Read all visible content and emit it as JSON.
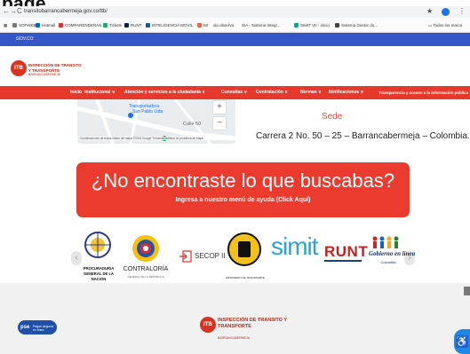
{
  "page_heading_fragment": "page",
  "browser": {
    "nav": [
      "←",
      "→",
      "C"
    ],
    "url": "transitobarrancabermeja.gov.co/ttb/",
    "right_icons": [
      "★",
      "⋮"
    ],
    "bookmarks": [
      "SOFWEB",
      "Hotmail",
      "COMPARENDERAS...",
      "Tickets",
      "RUNT",
      "INTELIGENCIA MOVIL",
      "MI",
      "sia observa",
      "SIA - Sistema Integr...",
      "SIMIT VII - inicio",
      "Sistema Gestor do..."
    ],
    "bookmarks_right": "Todos los marca"
  },
  "gov_label": "GOV.CO",
  "logo": {
    "name": "INSPECCIÓN DE TRANSITO Y TRANSPORTE",
    "sub": "BARRANCABERMEJA",
    "initials": "ITB"
  },
  "menu": [
    "Inicio",
    "Institucional ∨",
    "Atención y servicios a la ciudadanía ∨",
    "Consultas ∨",
    "Contratación ∨",
    "Normas ∨",
    "Notificaciones ∨",
    "Transparencia y acceso a la información pública"
  ],
  "map": {
    "label1": "Transportadora",
    "label2": "San Pablo Ltda",
    "road": "Calle 50",
    "plus": "+",
    "minus": "−",
    "footer": "Combinaciones de teclas   Datos del mapa ©2024 Google   Términos   Notificar un problema de Maps"
  },
  "sede": {
    "title": "Sede",
    "address": "Carrera 2 No. 50 – 25 – Barrancabermeja – Colombia."
  },
  "help": {
    "title": "¿No encontraste lo que buscabas?",
    "subtitle": "Ingresa a nuestro menú de ayuda (Click Aquí)"
  },
  "partners": {
    "prev": "‹",
    "next": "›",
    "procuraduria": "PROCURADURIA GENERAL DE LA NACION",
    "contraloria": "CONTRALORÍA",
    "contraloria_sub": "GENERAL DE LA REPÚBLICA",
    "secop": "SECOP II",
    "mintransporte": "MINISTERIO DE TRANSPORTE",
    "simit": "simit",
    "runt": "RUNT",
    "gobierno": "Gobierno en línea",
    "gobierno_sub": "Colombia"
  },
  "footer": {
    "pse": "pse",
    "pse_sub": "Pagos seguros en línea",
    "logo_name": "INSPECCIÓN DE TRANSITO Y TRANSPORTE",
    "logo_sub": "BARRANCABERMEJA",
    "access_icon": "♿"
  }
}
